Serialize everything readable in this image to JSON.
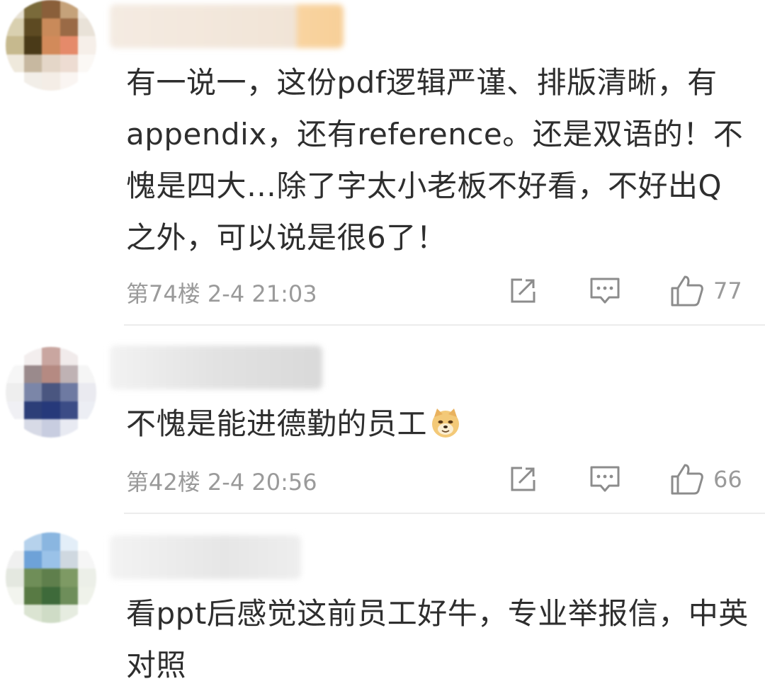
{
  "comments": [
    {
      "text": "有一说一，这份pdf逻辑严谨、排版清晰，有appendix，还有reference。还是双语的！不愧是四大…除了字太小老板不好看，不好出Q之外，可以说是很6了！",
      "floor": "第74楼",
      "time": "2-4 21:03",
      "likes": "77",
      "avatar_colors": [
        "#e8e2d4",
        "#7a6a3a",
        "#8a5f3a",
        "#c5a27a",
        "#f2ede6",
        "#d9d0b0",
        "#5d4a22",
        "#c98a5a",
        "#9a6a46",
        "#e9e2d8",
        "#c6b98e",
        "#4a3a18",
        "#d28a5a",
        "#e58a6a",
        "#f6efe9",
        "#efe9dc",
        "#c7b8a0",
        "#e4d6c8",
        "#eddcd2",
        "#fbf8f5",
        "#ffffff",
        "#f2eee8",
        "#f4ede6",
        "#faf5f2",
        "#ffffff"
      ],
      "name_blur_colors": [
        "#f1e6da",
        "#f7d2a0"
      ]
    },
    {
      "text": "不愧是能进德勤的员工",
      "floor": "第42楼",
      "time": "2-4 20:56",
      "likes": "66",
      "emoji": "doge-emoji",
      "avatar_colors": [
        "#ffffff",
        "#f3eeee",
        "#c9a6a0",
        "#f1ebeb",
        "#ffffff",
        "#f6f6f6",
        "#9a8a8c",
        "#b58a82",
        "#bfb2b4",
        "#f5f5f5",
        "#eeeeee",
        "#7b86a8",
        "#4a5680",
        "#6e7aa2",
        "#eaeaf0",
        "#f0f0f4",
        "#2c3e78",
        "#26397a",
        "#3b4c86",
        "#eceef4",
        "#ffffff",
        "#d7dae6",
        "#c8cde0",
        "#e8eaf2",
        "#ffffff"
      ],
      "name_blur_colors": [
        "#e9e9e9",
        "#d8d8d8"
      ]
    },
    {
      "text": "看ppt后感觉这前员工好牛，专业举报信，中英对照",
      "avatar_colors": [
        "#ffffff",
        "#b6d2ec",
        "#8ab6e0",
        "#e3eef8",
        "#ffffff",
        "#f0f0f0",
        "#6ea2d8",
        "#9ac2e8",
        "#cfd8e0",
        "#f6f6f6",
        "#e4e8e0",
        "#6f8e58",
        "#5f7f4c",
        "#7e9a64",
        "#ecefe8",
        "#f2f4ee",
        "#587a44",
        "#3e6a3a",
        "#6e8e5a",
        "#eff2ea",
        "#ffffff",
        "#dbe4d2",
        "#cfdcc6",
        "#e6ece0",
        "#ffffff"
      ],
      "name_blur_colors": [
        "#eeeeee",
        "#e2e2e2"
      ]
    }
  ],
  "icons": {
    "share": "share-icon",
    "reply": "comment-icon",
    "like": "thumbs-up-icon"
  },
  "colors": {
    "text": "#2e2e2e",
    "meta": "#9a9a9a",
    "divider": "#ececec",
    "icon": "#8c8c8c"
  }
}
